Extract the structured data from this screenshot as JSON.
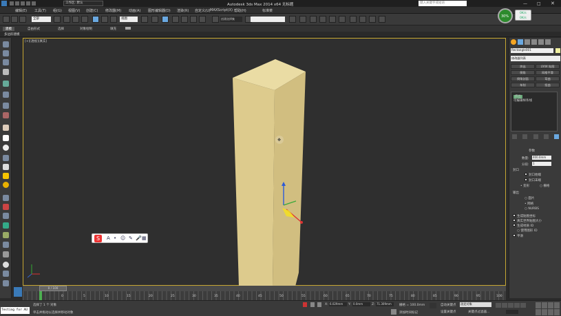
{
  "title": "Autodesk 3ds Max  2014 x64     无标题",
  "workspace": "工作区: 默认",
  "search_placeholder": "键入关键字或短语",
  "menu": [
    "编辑(E)",
    "工具(T)",
    "组(G)",
    "视图(V)",
    "创建(C)",
    "修改器(M)",
    "动画(A)",
    "图形编辑器(D)",
    "渲染(R)",
    "自定义(U)",
    "MAXScript(X)",
    "帮助(H)",
    "标准菜"
  ],
  "toolbar": {
    "selection_filter": "全部",
    "view": "视图",
    "named_set": "创建选择集"
  },
  "ribbon_tabs": [
    "建模",
    "自由形式",
    "选择",
    "对象绘制",
    "填充"
  ],
  "sub_ribbon": "多边形建模",
  "viewport_label": "[+][透视][真实]",
  "cpu": {
    "percent": "30%",
    "up": "0K/s",
    "down": "0K/s"
  },
  "panel": {
    "object_name": "Rectangle001",
    "modifier_list": "修改器列表",
    "buttons": [
      "挤出",
      "UVW 贴图",
      "倒角",
      "网格平滑",
      "倒角剖面",
      "弯曲",
      "车削",
      "扭曲"
    ],
    "stack": [
      "挤出",
      "可编辑样条线"
    ],
    "rollout_title": "参数",
    "amount_label": "数量:",
    "amount_value": "400.0mm",
    "segments_label": "分段:",
    "segments_value": "1",
    "capping_title": "封口",
    "cap_start": "封口始端",
    "cap_end": "封口末端",
    "morph": "变形",
    "grid": "栅格",
    "output_title": "输出",
    "out_patch": "面片",
    "out_mesh": "网格",
    "out_nurbs": "NURBS",
    "gen_mapping": "生成贴图坐标",
    "real_world": "真实世界贴图大小",
    "gen_mat_ids": "生成材质 ID",
    "use_shape_ids": "使用图形 ID",
    "smooth": "平滑"
  },
  "timeline": {
    "frame": "0 / 100",
    "ticks": [
      "0",
      "5",
      "10",
      "15",
      "20",
      "25",
      "30",
      "35",
      "40",
      "45",
      "50",
      "55",
      "60",
      "65",
      "70",
      "75",
      "80",
      "85",
      "90",
      "95",
      "100"
    ]
  },
  "status": {
    "selected": "选择了 1 个 对象",
    "hint": "单击并拖动以选择并移动对象",
    "x_label": "X:",
    "x": "6.029mm",
    "y_label": "Y:",
    "y": "0.0mm",
    "z_label": "Z:",
    "z": "71.309mm",
    "grid": "栅格 = 100.0mm",
    "auto_key": "自动关键点",
    "set_key": "设置关键点",
    "selected_obj": "选定对象",
    "key_filter": "关键点过滤器...",
    "add_time_tag": "添加时间标记",
    "script_box": "Testing for AU"
  },
  "colors": {
    "box_light": "#e8d9a0",
    "box_mid": "#d9c88a",
    "box_dark": "#c7b476",
    "viewport_border": "#c8a832"
  }
}
